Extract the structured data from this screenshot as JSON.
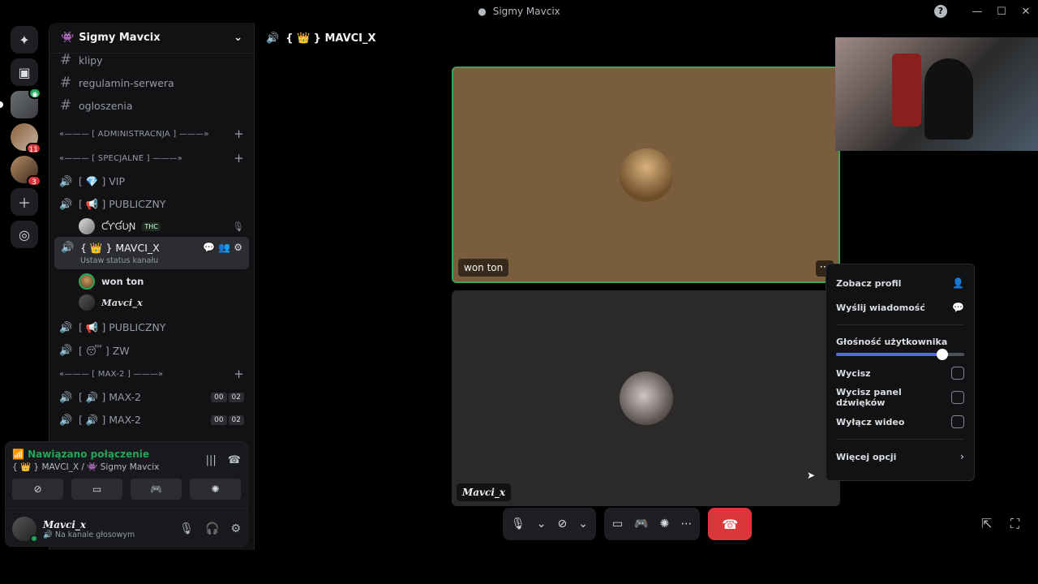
{
  "window": {
    "title": "Sigmy Mavcix"
  },
  "server": {
    "name": "Sigmy Mavcix"
  },
  "channels_top": [
    {
      "name": "klipy"
    },
    {
      "name": "regulamin-serwera"
    },
    {
      "name": "ogloszenia"
    }
  ],
  "categories": {
    "admin": "«——— [ ADMINISTRACNJA ] ———»",
    "special": "«——— [ SPECJALNE ] ———»",
    "max2": "«——— [ MAX-2 ] ———»"
  },
  "voice_channels": {
    "vip": "[ 💎 ] VIP",
    "publiczny1": "[ 📢 ] PUBLICZNY",
    "user_cygun": "ƇƳƓƲƝ",
    "tag_thc": "THC",
    "mavci": "{ 👑 } MAVCI_X",
    "mavci_sub": "Ustaw status kanału",
    "user_won": "won ton",
    "user_mavci": "Mavci_x",
    "publiczny2": "[ 📢 ] PUBLICZNY",
    "zw": "[ 😴 ] ZW",
    "max2a": "[ 🔊 ] MAX-2",
    "max2b": "[ 🔊 ] MAX-2",
    "counter_a": "00",
    "counter_b": "02"
  },
  "voice_panel": {
    "status": "Nawiązano połączenie",
    "location": "{ 👑 } MAVCI_X / 👾 Sigmy Mavcix",
    "user_name": "Mavci_x",
    "user_status": "🔊 Na kanale głosowym"
  },
  "server_badges": {
    "s2": "11",
    "s3": "3"
  },
  "main": {
    "channel_title": "{ 👑 } MAVCI_X",
    "tile1_label": "won ton",
    "tile2_label": "Mavci_x"
  },
  "context_menu": {
    "view_profile": "Zobacz profil",
    "send_message": "Wyślij wiadomość",
    "user_volume": "Głośność użytkownika",
    "volume_level": 0.83,
    "mute": "Wycisz",
    "mute_soundboard": "Wycisz panel dźwięków",
    "disable_video": "Wyłącz wideo",
    "more_options": "Więcej opcji"
  },
  "colors": {
    "accent": "#5865f2",
    "online": "#23a55a",
    "danger": "#da373c"
  }
}
